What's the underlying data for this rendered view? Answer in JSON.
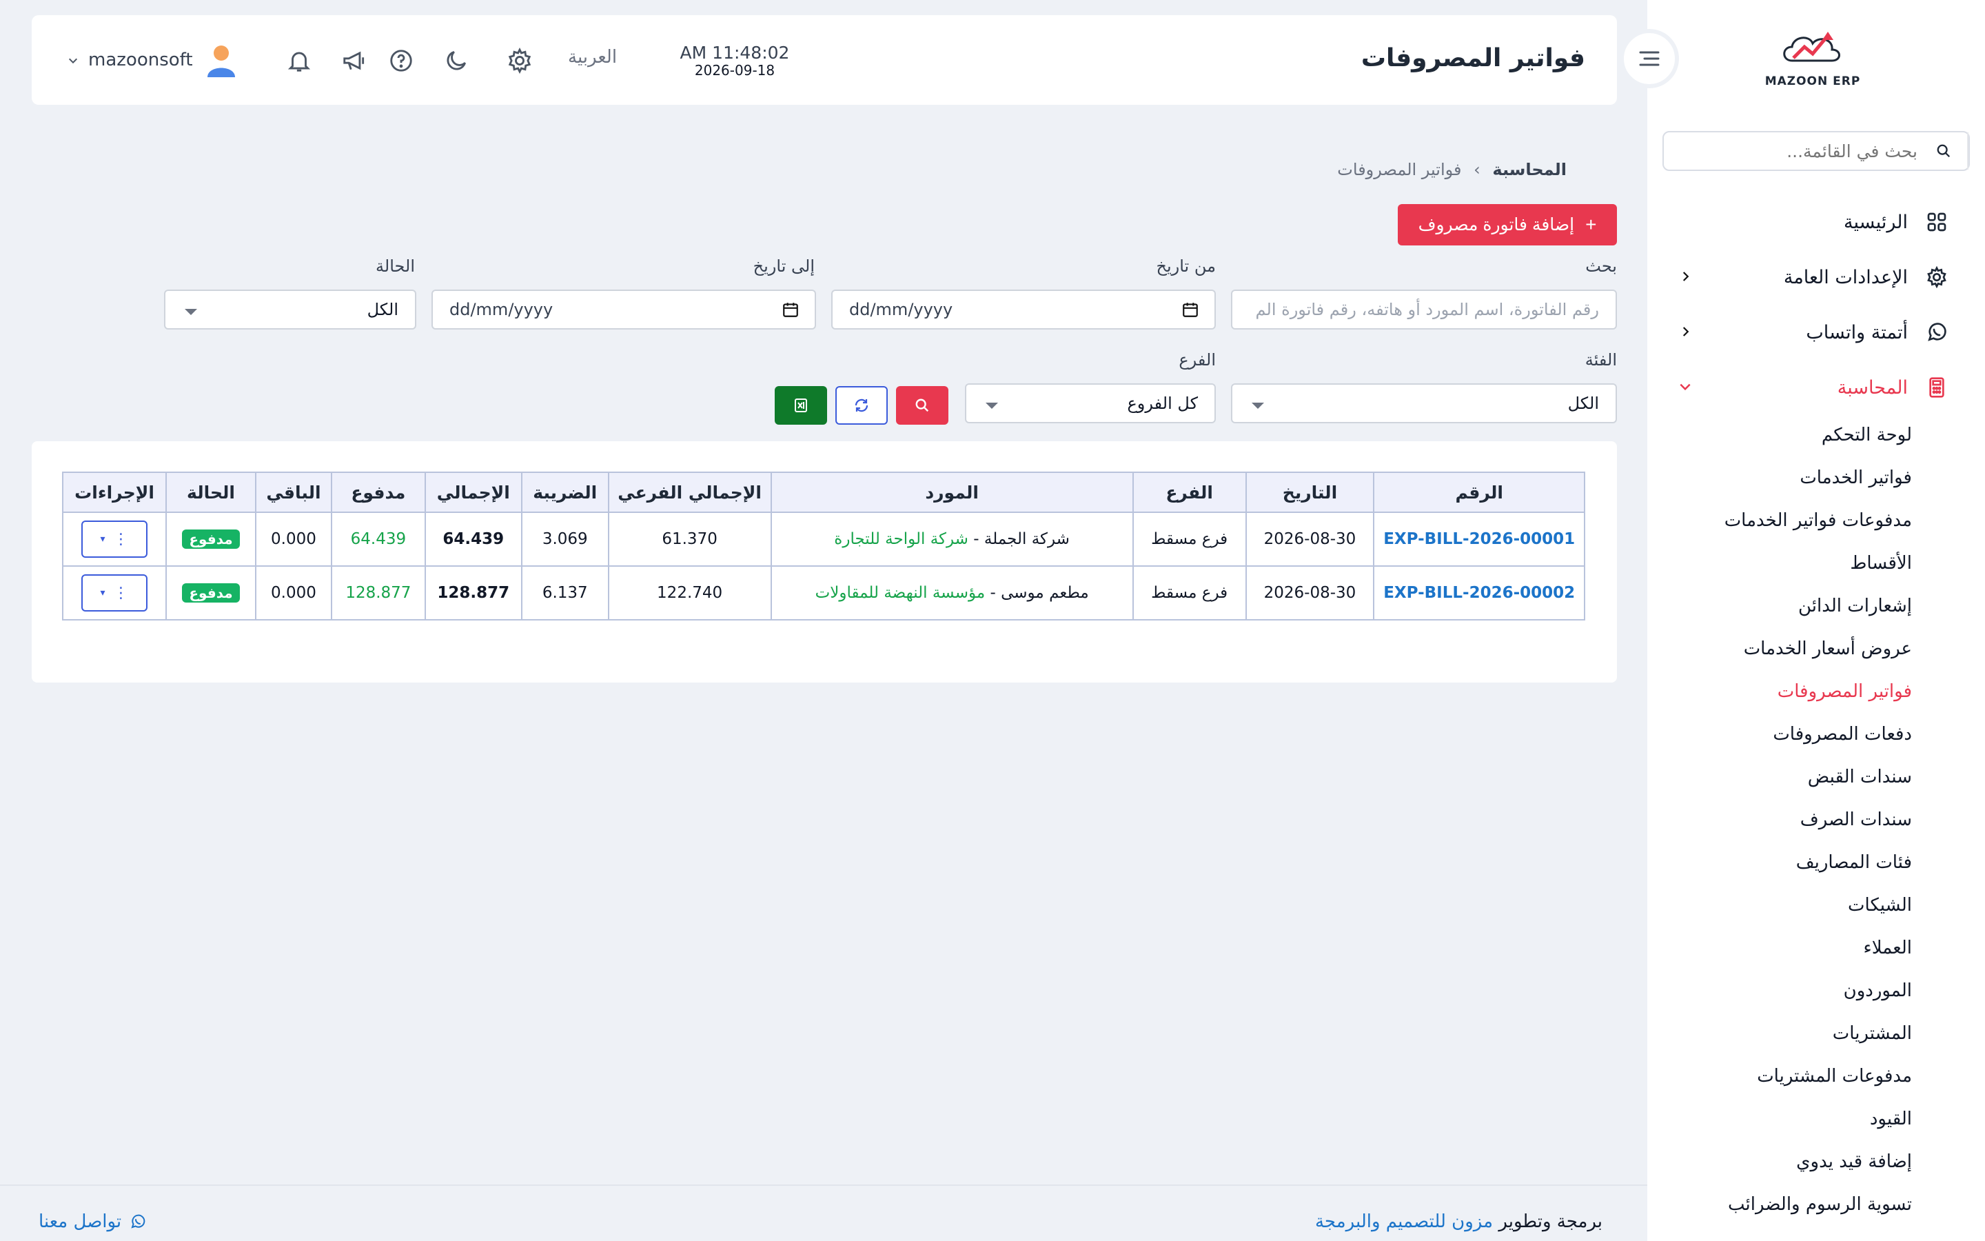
{
  "app": {
    "name": "MAZOON ERP",
    "logo_tag": "ERP"
  },
  "sidebar": {
    "search_placeholder": "بحث في القائمة...",
    "items": [
      {
        "label": "الرئيسية",
        "icon": "grid-icon"
      },
      {
        "label": "الإعدادات العامة",
        "icon": "gear-icon"
      },
      {
        "label": "أتمتة واتساب",
        "icon": "whatsapp-icon"
      },
      {
        "label": "المحاسبة",
        "icon": "calculator-icon"
      }
    ],
    "sub_items": [
      "لوحة التحكم",
      "فواتير الخدمات",
      "مدفوعات فواتير الخدمات",
      "الأقساط",
      "إشعارات الدائن",
      "عروض أسعار الخدمات",
      "فواتير المصروفات",
      "دفعات المصروفات",
      "سندات القبض",
      "سندات الصرف",
      "فئات المصاريف",
      "الشيكات",
      "العملاء",
      "الموردون",
      "المشتريات",
      "مدفوعات المشتريات",
      "القيود",
      "إضافة قيد يدوي",
      "تسوية الرسوم والضرائب"
    ],
    "active_sub": "فواتير المصروفات"
  },
  "header": {
    "title": "فواتير المصروفات",
    "time": "AM 11:48:02",
    "date": "2026-09-18",
    "language": "العربية",
    "username": "mazoonsoft"
  },
  "breadcrumb": {
    "parent": "المحاسبة",
    "sep": "›",
    "current": "فواتير المصروفات"
  },
  "add_button": "إضافة فاتورة مصروف",
  "filters": {
    "search_label": "بحث",
    "search_placeholder": "رقم الفاتورة، اسم المورد أو هاتفه، رقم فاتورة الم",
    "from_label": "من تاريخ",
    "to_label": "إلى تاريخ",
    "date_placeholder": "dd/mm/yyyy",
    "status_label": "الحالة",
    "status_value": "الكل",
    "category_label": "الفئة",
    "category_value": "الكل",
    "branch_label": "الفرع",
    "branch_value": "كل الفروع"
  },
  "table": {
    "headers": [
      "الرقم",
      "التاريخ",
      "الفرع",
      "المورد",
      "الإجمالي الفرعي",
      "الضريبة",
      "الإجمالي",
      "مدفوع",
      "الباقي",
      "الحالة",
      "الإجراءات"
    ],
    "rows": [
      {
        "number": "EXP-BILL-2026-00001",
        "date": "2026-08-30",
        "branch": "فرع مسقط",
        "supplier_a": "شركة الجملة",
        "supplier_sep": " - ",
        "supplier_b": "شركة الواحة للتجارة",
        "subtotal": "61.370",
        "tax": "3.069",
        "total": "64.439",
        "paid": "64.439",
        "remaining": "0.000",
        "status": "مدفوع"
      },
      {
        "number": "EXP-BILL-2026-00002",
        "date": "2026-08-30",
        "branch": "فرع مسقط",
        "supplier_a": "مطعم موسى",
        "supplier_sep": " - ",
        "supplier_b": "مؤسسة النهضة للمقاولات",
        "subtotal": "122.740",
        "tax": "6.137",
        "total": "128.877",
        "paid": "128.877",
        "remaining": "0.000",
        "status": "مدفوع"
      }
    ]
  },
  "footer": {
    "prefix": "برمجة وتطوير",
    "company": "مزون للتصميم والبرمجة",
    "contact": "تواصل معنا"
  },
  "colors": {
    "accent": "#e8384f",
    "link": "#1c74c9",
    "success": "#16b364",
    "excel": "#0f7a2a"
  }
}
